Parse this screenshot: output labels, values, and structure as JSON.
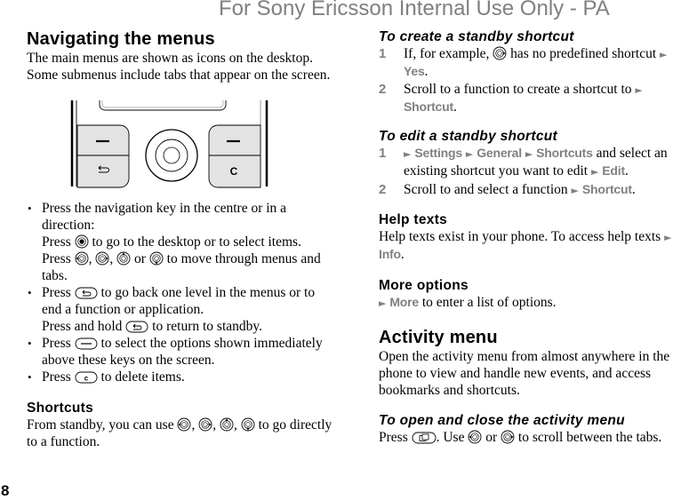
{
  "watermark": "For Sony Ericsson Internal Use Only - PA",
  "page_number": "8",
  "left": {
    "heading": "Navigating the menus",
    "intro": "The main menus are shown as icons on the desktop. Some submenus include tabs that appear on the screen.",
    "illustration": {
      "keys": [
        "left-selection-key",
        "back-key",
        "navigation-key",
        "right-selection-key",
        "clear-key"
      ],
      "clear_key_label": "C"
    },
    "bullets": [
      {
        "lines": [
          "Press the navigation key in the centre or in a direction:",
          {
            "pre": "Press",
            "icon": "nav-centre-icon",
            "post": "to go to the desktop or to select items."
          },
          {
            "pre": "Press",
            "icons": [
              "nav-left-icon",
              "nav-right-icon",
              "nav-up-icon",
              "nav-down-icon"
            ],
            "sep": [
              ",",
              ",",
              "or"
            ],
            "post": "to move through menus and tabs."
          }
        ]
      },
      {
        "lines": [
          {
            "pre": "Press",
            "icon": "back-key-icon",
            "post": "to go back one level in the menus or to end a function or application."
          },
          {
            "pre": "Press and hold",
            "icon": "back-key-icon",
            "post": "to return to standby."
          }
        ]
      },
      {
        "lines": [
          {
            "pre": "Press",
            "icon": "selection-key-icon",
            "post": "to select the options shown immediately above these keys on the screen."
          }
        ]
      },
      {
        "lines": [
          {
            "pre": "Press",
            "icon": "clear-key-icon",
            "post": "to delete items."
          }
        ]
      }
    ],
    "shortcuts": {
      "heading": "Shortcuts",
      "pre": "From standby, you can use",
      "sep1": ",",
      "sep2": ",",
      "sep3": ",",
      "post": "to go directly to a function."
    }
  },
  "right": {
    "create": {
      "heading": "To create a standby shortcut",
      "steps": [
        {
          "num": "1",
          "pre": "If, for example,",
          "post": "has no predefined shortcut",
          "menu": [
            "Yes"
          ],
          "end": "."
        },
        {
          "num": "2",
          "pre": "Scroll to a function to create a shortcut to",
          "menu": [
            "Shortcut"
          ],
          "end": "."
        }
      ]
    },
    "edit": {
      "heading": "To edit a standby shortcut",
      "steps": [
        {
          "num": "1",
          "menu": [
            "Settings",
            "General",
            "Shortcuts"
          ],
          "mid": "and select an existing shortcut you want to edit",
          "menu2": [
            "Edit"
          ],
          "end": "."
        },
        {
          "num": "2",
          "pre": "Scroll to and select a function",
          "menu": [
            "Shortcut"
          ],
          "end": "."
        }
      ]
    },
    "help": {
      "heading": "Help texts",
      "text": "Help texts exist in your phone. To access help texts",
      "menu": [
        "Info"
      ],
      "end": "."
    },
    "more": {
      "heading": "More options",
      "menu": [
        "More"
      ],
      "text": "to enter a list of options."
    },
    "activity": {
      "heading": "Activity menu",
      "text": "Open the activity menu from almost anywhere in the phone to view and handle new events, and access bookmarks and shortcuts."
    },
    "open_close": {
      "heading": "To open and close the activity menu",
      "pre": "Press",
      "mid": ". Use",
      "or": "or",
      "post": "to scroll between the tabs."
    }
  },
  "colors": {
    "highlight": "#808080",
    "watermark": "#808080",
    "key_fill": "#e6e6e6"
  }
}
